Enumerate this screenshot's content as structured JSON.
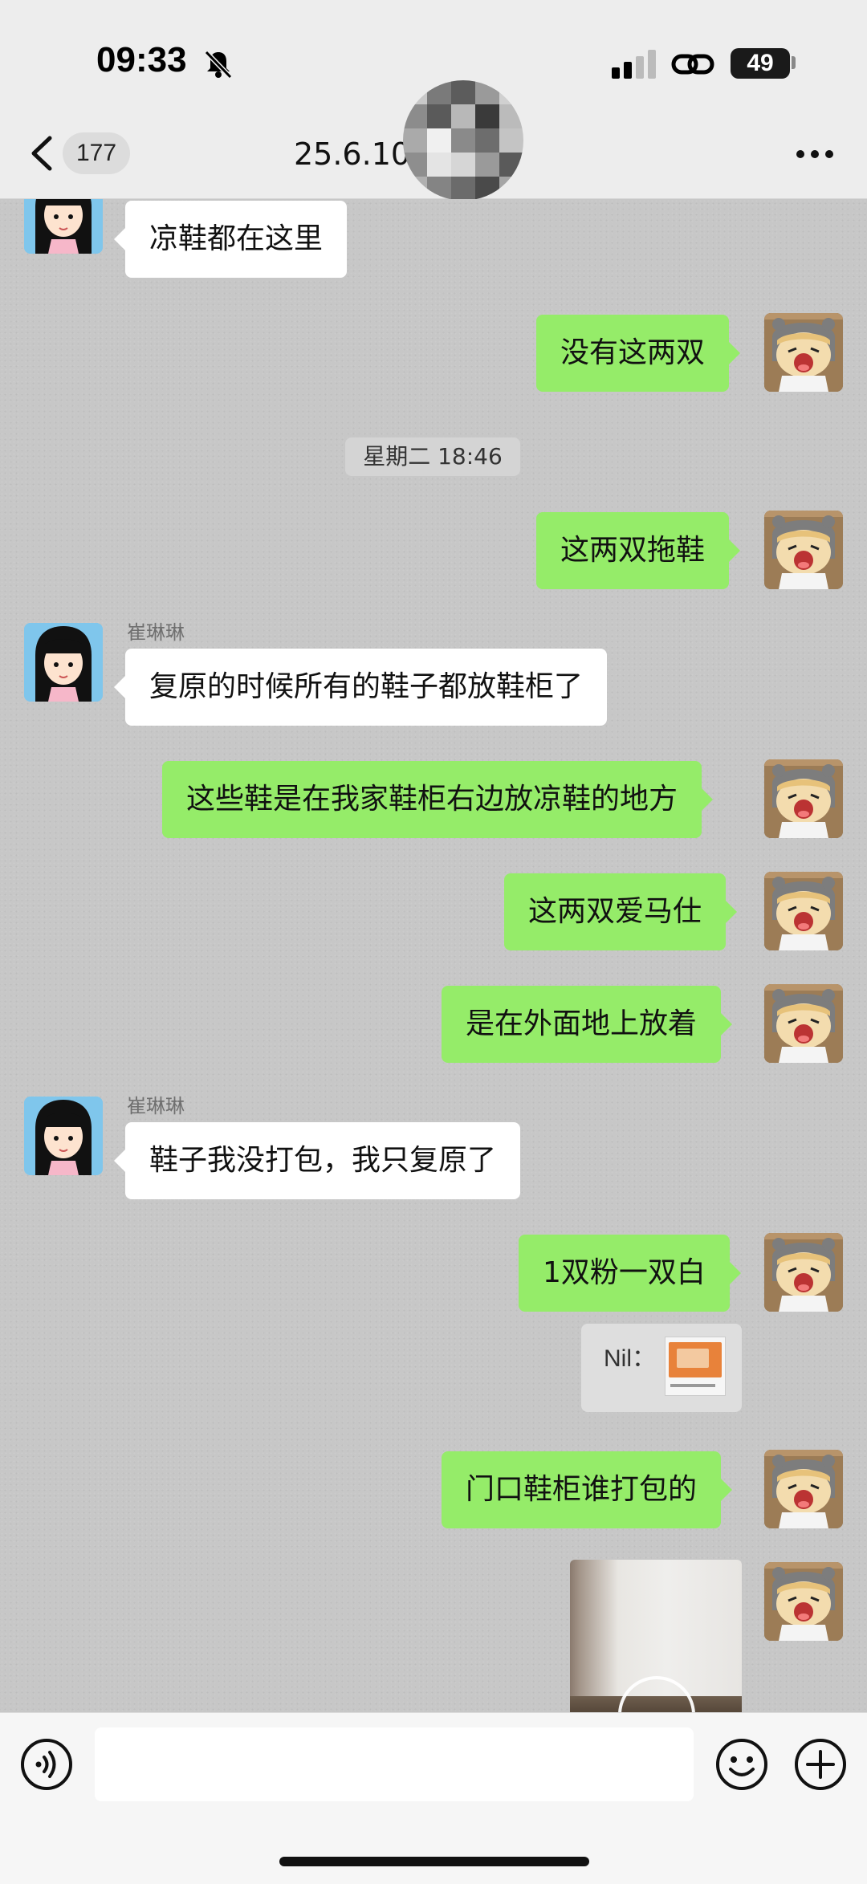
{
  "status_bar": {
    "time": "09:33",
    "battery": "49"
  },
  "header": {
    "back_badge": "177",
    "title": "25.6.10                 (7)"
  },
  "messages": [
    {
      "id": "m1",
      "direction": "in",
      "text": "凉鞋都在这里"
    },
    {
      "id": "m2",
      "direction": "out",
      "text": "没有这两双"
    },
    {
      "id": "m3",
      "direction": "out",
      "text": "这两双拖鞋"
    },
    {
      "id": "m4",
      "direction": "in",
      "sender": "崔琳琳",
      "text": "复原的时候所有的鞋子都放鞋柜了"
    },
    {
      "id": "m5",
      "direction": "out",
      "text": "这些鞋是在我家鞋柜右边放凉鞋的地方"
    },
    {
      "id": "m6",
      "direction": "out",
      "text": "这两双爱马仕"
    },
    {
      "id": "m7",
      "direction": "out",
      "text": "是在外面地上放着"
    },
    {
      "id": "m8",
      "direction": "in",
      "sender": "崔琳琳",
      "text": "鞋子我没打包，我只复原了"
    },
    {
      "id": "m9",
      "direction": "out",
      "text": "1双粉一双白"
    },
    {
      "id": "m10",
      "direction": "out",
      "text": "门口鞋柜谁打包的"
    }
  ],
  "timestamp": "星期二 18:46",
  "quote": {
    "label": "Nil："
  },
  "icons": {
    "back": "chevron-left-icon",
    "more": "more-dots-icon",
    "voice": "voice-icon",
    "emoji": "emoji-icon",
    "plus": "plus-icon",
    "bell_off": "bell-off-icon",
    "link": "link-icon"
  },
  "colors": {
    "outgoing_bubble": "#95ec69",
    "incoming_bubble": "#ffffff",
    "chat_background": "#c7c7c7"
  }
}
